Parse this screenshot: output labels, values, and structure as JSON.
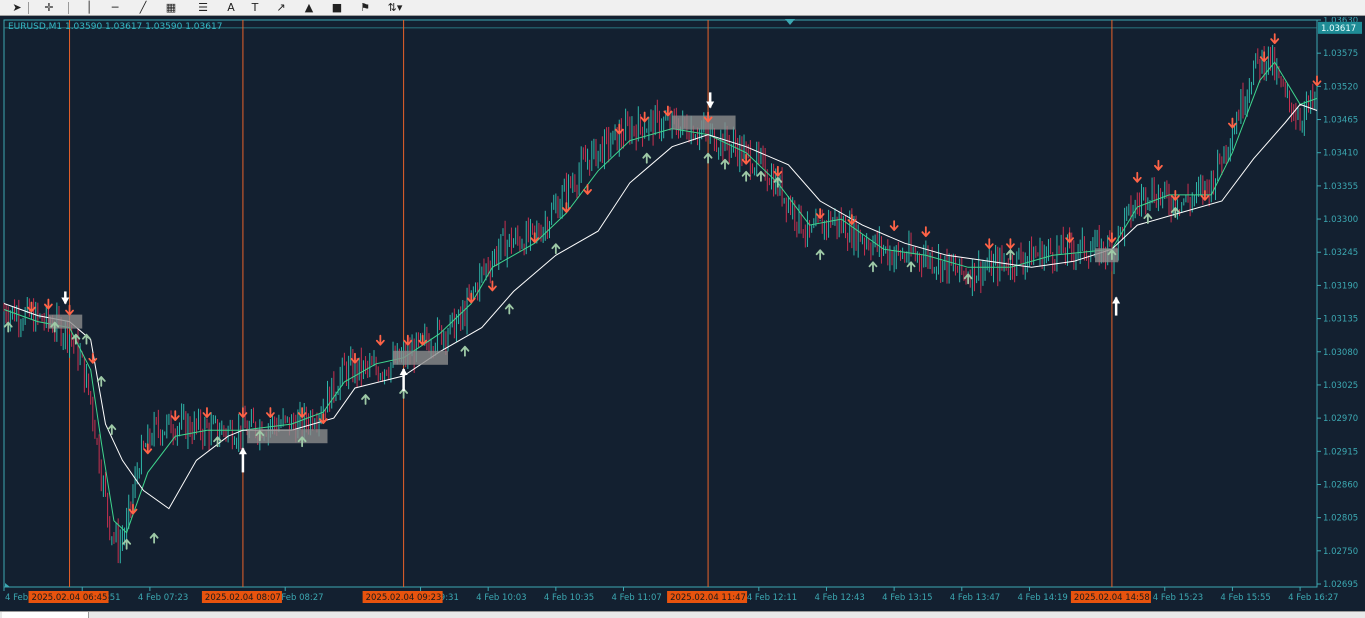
{
  "toolbar": {
    "tools": [
      {
        "name": "cursor-arrow-icon",
        "glyph": "➤"
      },
      {
        "name": "crosshair-icon",
        "glyph": "✛"
      },
      {
        "name": "vertical-line-icon",
        "glyph": "│"
      },
      {
        "name": "horizontal-line-icon",
        "glyph": "─"
      },
      {
        "name": "trendline-icon",
        "glyph": "╱"
      },
      {
        "name": "fibonacci-channel-icon",
        "glyph": "▦"
      },
      {
        "name": "fibonacci-retracement-icon",
        "glyph": "☰"
      },
      {
        "name": "text-icon",
        "glyph": "A"
      },
      {
        "name": "text-label-icon",
        "glyph": "T"
      },
      {
        "name": "arrow-draw-icon",
        "glyph": "↗"
      },
      {
        "name": "triangle-icon",
        "glyph": "▲"
      },
      {
        "name": "rectangle-icon",
        "glyph": "■"
      },
      {
        "name": "fibo-fan-icon",
        "glyph": "⚑"
      },
      {
        "name": "arrows-dropdown-icon",
        "glyph": "⇅▾"
      }
    ]
  },
  "symbol_info": "EURUSD,M1  1.03590 1.03617 1.03590 1.03617",
  "colors": {
    "background": "#132030",
    "grid": "#2a3c4e",
    "bull_candle": "#2fb6a9",
    "bear_candle": "#c8304f",
    "green_line": "#3fd68e",
    "white_line": "#ffffff",
    "marker_line": "#e8622a",
    "marker_label_bg": "#e8530e",
    "sell_arrow": "#ff6347",
    "buy_arrow": "#9ec9a6",
    "price_axis": "#3ca8b2",
    "time_axis": "#3ca8b2"
  },
  "chart_data": {
    "type": "candlestick",
    "symbol": "EURUSD",
    "timeframe": "M1",
    "ohlc_current": {
      "open": 1.0359,
      "high": 1.03617,
      "low": 1.0359,
      "close": 1.03617
    },
    "current_price_label": "1.03617",
    "ylim": [
      1.02695,
      1.0363
    ],
    "price_ticks": [
      "1.03630",
      "1.03575",
      "1.03520",
      "1.03465",
      "1.03410",
      "1.03355",
      "1.03300",
      "1.03245",
      "1.03190",
      "1.03135",
      "1.03080",
      "1.03025",
      "1.02970",
      "1.02915",
      "1.02860",
      "1.02805",
      "1.02750",
      "1.02695"
    ],
    "time_ticks": [
      "4 Feb 2025",
      "4 Feb 06:51",
      "4 Feb 07:23",
      "4 Feb 08:27",
      "4 Feb 09:31",
      "4 Feb 10:03",
      "4 Feb 10:35",
      "4 Feb 11:07",
      "4 Feb 12:11",
      "4 Feb 12:43",
      "4 Feb 13:15",
      "4 Feb 13:47",
      "4 Feb 14:19",
      "4 Feb 15:23",
      "4 Feb 15:55",
      "4 Feb 16:27"
    ],
    "time_range": [
      "2025.02.04 06:14",
      "2025.02.04 16:35"
    ],
    "vertical_markers": [
      {
        "time": "2025.02.04 06:45",
        "label": "2025.02.04 06:45"
      },
      {
        "time": "2025.02.04 08:07",
        "label": "2025.02.04 08:07"
      },
      {
        "time": "2025.02.04 09:23",
        "label": "2025.02.04 09:23"
      },
      {
        "time": "2025.02.04 11:47",
        "label": "2025.02.04 11:47"
      },
      {
        "time": "2025.02.04 14:58",
        "label": "2025.02.04 14:58"
      }
    ],
    "close_path": [
      [
        "06:14",
        1.0315
      ],
      [
        "06:25",
        1.0314
      ],
      [
        "06:35",
        1.0313
      ],
      [
        "06:45",
        1.0311
      ],
      [
        "06:50",
        1.0307
      ],
      [
        "06:55",
        1.03
      ],
      [
        "07:00",
        1.0288
      ],
      [
        "07:04",
        1.0279
      ],
      [
        "07:08",
        1.0276
      ],
      [
        "07:12",
        1.0279
      ],
      [
        "07:18",
        1.029
      ],
      [
        "07:25",
        1.0295
      ],
      [
        "07:35",
        1.0296
      ],
      [
        "07:50",
        1.0295
      ],
      [
        "08:07",
        1.0295
      ],
      [
        "08:20",
        1.0296
      ],
      [
        "08:35",
        1.0296
      ],
      [
        "08:45",
        1.0299
      ],
      [
        "08:55",
        1.0305
      ],
      [
        "09:10",
        1.0305
      ],
      [
        "09:23",
        1.0307
      ],
      [
        "09:35",
        1.031
      ],
      [
        "09:50",
        1.0313
      ],
      [
        "10:00",
        1.0321
      ],
      [
        "10:10",
        1.0326
      ],
      [
        "10:25",
        1.0327
      ],
      [
        "10:35",
        1.0332
      ],
      [
        "10:50",
        1.034
      ],
      [
        "11:10",
        1.0345
      ],
      [
        "11:25",
        1.0346
      ],
      [
        "11:40",
        1.0345
      ],
      [
        "11:47",
        1.0344
      ],
      [
        "12:00",
        1.0342
      ],
      [
        "12:15",
        1.0338
      ],
      [
        "12:25",
        1.0333
      ],
      [
        "12:35",
        1.0327
      ],
      [
        "12:45",
        1.033
      ],
      [
        "13:00",
        1.0327
      ],
      [
        "13:15",
        1.0324
      ],
      [
        "13:30",
        1.0324
      ],
      [
        "13:47",
        1.0321
      ],
      [
        "14:00",
        1.0322
      ],
      [
        "14:20",
        1.0324
      ],
      [
        "14:40",
        1.0325
      ],
      [
        "14:58",
        1.0325
      ],
      [
        "15:05",
        1.033
      ],
      [
        "15:15",
        1.0335
      ],
      [
        "15:25",
        1.0333
      ],
      [
        "15:35",
        1.0333
      ],
      [
        "15:45",
        1.0336
      ],
      [
        "15:55",
        1.0345
      ],
      [
        "16:05",
        1.0355
      ],
      [
        "16:12",
        1.0357
      ],
      [
        "16:20",
        1.035
      ],
      [
        "16:27",
        1.0347
      ],
      [
        "16:35",
        1.035
      ]
    ],
    "series": [
      {
        "name": "",
        "color": "#3fd68e",
        "points": [
          [
            "06:14",
            1.0315
          ],
          [
            "06:30",
            1.0313
          ],
          [
            "06:45",
            1.0312
          ],
          [
            "06:55",
            1.0305
          ],
          [
            "07:00",
            1.0293
          ],
          [
            "07:06",
            1.028
          ],
          [
            "07:12",
            1.0278
          ],
          [
            "07:22",
            1.0288
          ],
          [
            "07:35",
            1.0294
          ],
          [
            "07:50",
            1.0295
          ],
          [
            "08:07",
            1.0295
          ],
          [
            "08:30",
            1.0296
          ],
          [
            "08:45",
            1.0298
          ],
          [
            "08:55",
            1.0303
          ],
          [
            "09:10",
            1.0306
          ],
          [
            "09:23",
            1.0307
          ],
          [
            "09:40",
            1.0311
          ],
          [
            "09:55",
            1.0316
          ],
          [
            "10:05",
            1.0322
          ],
          [
            "10:25",
            1.0326
          ],
          [
            "10:40",
            1.0331
          ],
          [
            "10:55",
            1.0338
          ],
          [
            "11:10",
            1.0343
          ],
          [
            "11:30",
            1.0345
          ],
          [
            "11:47",
            1.0344
          ],
          [
            "12:05",
            1.0341
          ],
          [
            "12:20",
            1.0336
          ],
          [
            "12:35",
            1.0329
          ],
          [
            "12:50",
            1.033
          ],
          [
            "13:10",
            1.0325
          ],
          [
            "13:30",
            1.0324
          ],
          [
            "13:50",
            1.0322
          ],
          [
            "14:10",
            1.0322
          ],
          [
            "14:30",
            1.0324
          ],
          [
            "14:58",
            1.0325
          ],
          [
            "15:10",
            1.0332
          ],
          [
            "15:25",
            1.0334
          ],
          [
            "15:45",
            1.0334
          ],
          [
            "15:55",
            1.0341
          ],
          [
            "16:08",
            1.0353
          ],
          [
            "16:15",
            1.0356
          ],
          [
            "16:27",
            1.0349
          ],
          [
            "16:35",
            1.035
          ]
        ]
      },
      {
        "name": "",
        "color": "#ffffff",
        "points": [
          [
            "06:14",
            1.0316
          ],
          [
            "06:30",
            1.0314
          ],
          [
            "06:45",
            1.0313
          ],
          [
            "06:55",
            1.031
          ],
          [
            "07:02",
            1.0296
          ],
          [
            "07:10",
            1.029
          ],
          [
            "07:20",
            1.0285
          ],
          [
            "07:32",
            1.0282
          ],
          [
            "07:45",
            1.029
          ],
          [
            "08:00",
            1.0294
          ],
          [
            "08:07",
            1.0295
          ],
          [
            "08:30",
            1.0295
          ],
          [
            "08:50",
            1.0297
          ],
          [
            "09:00",
            1.0302
          ],
          [
            "09:23",
            1.0304
          ],
          [
            "09:40",
            1.0308
          ],
          [
            "10:00",
            1.0312
          ],
          [
            "10:15",
            1.0318
          ],
          [
            "10:35",
            1.0324
          ],
          [
            "10:55",
            1.0328
          ],
          [
            "11:10",
            1.0336
          ],
          [
            "11:30",
            1.0342
          ],
          [
            "11:47",
            1.0344
          ],
          [
            "12:05",
            1.0342
          ],
          [
            "12:25",
            1.0339
          ],
          [
            "12:40",
            1.0333
          ],
          [
            "13:00",
            1.0329
          ],
          [
            "13:20",
            1.0326
          ],
          [
            "13:40",
            1.0324
          ],
          [
            "14:00",
            1.0323
          ],
          [
            "14:20",
            1.0322
          ],
          [
            "14:40",
            1.0323
          ],
          [
            "14:58",
            1.0325
          ],
          [
            "15:10",
            1.0329
          ],
          [
            "15:30",
            1.0331
          ],
          [
            "15:50",
            1.0333
          ],
          [
            "16:05",
            1.034
          ],
          [
            "16:20",
            1.0346
          ],
          [
            "16:27",
            1.0349
          ],
          [
            "16:35",
            1.0348
          ]
        ]
      }
    ],
    "sell_signals": [
      [
        "06:27",
        1.03155
      ],
      [
        "06:35",
        1.0316
      ],
      [
        "06:45",
        1.0315
      ],
      [
        "06:56",
        1.0307
      ],
      [
        "07:15",
        1.0282
      ],
      [
        "07:22",
        1.0292
      ],
      [
        "07:35",
        1.02975
      ],
      [
        "07:50",
        1.0298
      ],
      [
        "08:07",
        1.0298
      ],
      [
        "08:20",
        1.0298
      ],
      [
        "08:35",
        1.0298
      ],
      [
        "08:45",
        1.0297
      ],
      [
        "09:00",
        1.0307
      ],
      [
        "09:12",
        1.031
      ],
      [
        "09:25",
        1.031
      ],
      [
        "09:32",
        1.031
      ],
      [
        "09:55",
        1.0317
      ],
      [
        "10:05",
        1.0319
      ],
      [
        "10:25",
        1.0327
      ],
      [
        "10:40",
        1.0332
      ],
      [
        "10:50",
        1.0335
      ],
      [
        "11:05",
        1.0345
      ],
      [
        "11:17",
        1.0347
      ],
      [
        "11:28",
        1.0348
      ],
      [
        "11:47",
        1.0347
      ],
      [
        "12:05",
        1.034
      ],
      [
        "12:20",
        1.0338
      ],
      [
        "12:40",
        1.0331
      ],
      [
        "12:55",
        1.033
      ],
      [
        "13:15",
        1.0329
      ],
      [
        "13:30",
        1.0328
      ],
      [
        "14:00",
        1.0326
      ],
      [
        "14:10",
        1.0326
      ],
      [
        "14:38",
        1.0327
      ],
      [
        "14:58",
        1.0327
      ],
      [
        "15:10",
        1.0337
      ],
      [
        "15:20",
        1.0339
      ],
      [
        "15:28",
        1.0334
      ],
      [
        "15:42",
        1.0334
      ],
      [
        "15:55",
        1.0346
      ],
      [
        "16:10",
        1.0357
      ],
      [
        "16:15",
        1.036
      ],
      [
        "16:35",
        1.0353
      ]
    ],
    "buy_signals": [
      [
        "06:16",
        1.0312
      ],
      [
        "06:38",
        1.0312
      ],
      [
        "06:48",
        1.031
      ],
      [
        "06:53",
        1.031
      ],
      [
        "07:00",
        1.0303
      ],
      [
        "07:05",
        1.0295
      ],
      [
        "07:12",
        1.0276
      ],
      [
        "07:25",
        1.0277
      ],
      [
        "07:55",
        1.0293
      ],
      [
        "08:15",
        1.0294
      ],
      [
        "08:35",
        1.0293
      ],
      [
        "09:05",
        1.03
      ],
      [
        "09:23",
        1.0301
      ],
      [
        "09:52",
        1.0308
      ],
      [
        "10:13",
        1.0315
      ],
      [
        "10:35",
        1.0325
      ],
      [
        "11:18",
        1.034
      ],
      [
        "11:47",
        1.034
      ],
      [
        "11:55",
        1.0339
      ],
      [
        "12:05",
        1.0337
      ],
      [
        "12:12",
        1.0337
      ],
      [
        "12:20",
        1.0336
      ],
      [
        "12:40",
        1.0324
      ],
      [
        "13:05",
        1.0322
      ],
      [
        "13:23",
        1.0322
      ],
      [
        "13:50",
        1.032
      ],
      [
        "14:10",
        1.0324
      ],
      [
        "14:58",
        1.0324
      ],
      [
        "15:15",
        1.033
      ],
      [
        "15:28",
        1.0331
      ]
    ],
    "zones": [
      {
        "t0": "06:35",
        "t1": "06:51",
        "price": 1.0313
      },
      {
        "t0": "08:09",
        "t1": "08:47",
        "price": 1.0294
      },
      {
        "t0": "09:18",
        "t1": "09:44",
        "price": 1.0307
      },
      {
        "t0": "11:30",
        "t1": "12:00",
        "price": 1.0346
      },
      {
        "t0": "14:50",
        "t1": "15:01",
        "price": 1.0324
      }
    ],
    "annotation_arrows": [
      {
        "time": "06:43",
        "from": 1.0318,
        "to": 1.0316,
        "dir": "down"
      },
      {
        "time": "08:07",
        "from": 1.0288,
        "to": 1.0292,
        "dir": "up"
      },
      {
        "time": "09:23",
        "from": 1.03015,
        "to": 1.03025,
        "dir": "up"
      },
      {
        "time": "11:48",
        "from": 1.0351,
        "to": 1.03485,
        "dir": "down"
      },
      {
        "time": "15:00",
        "from": 1.0314,
        "to": 1.0317,
        "dir": "up"
      }
    ]
  }
}
